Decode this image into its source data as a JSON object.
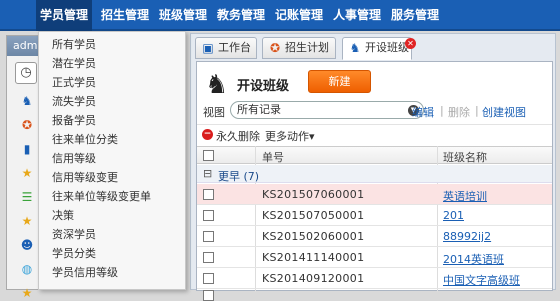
{
  "nav": {
    "items": [
      {
        "label": "学员管理",
        "active": true
      },
      {
        "label": "招生管理",
        "active": false
      },
      {
        "label": "班级管理",
        "active": false
      },
      {
        "label": "教务管理",
        "active": false
      },
      {
        "label": "记账管理",
        "active": false
      },
      {
        "label": "人事管理",
        "active": false
      },
      {
        "label": "服务管理",
        "active": false
      }
    ]
  },
  "left_panel": {
    "header": "adm"
  },
  "dropdown": {
    "items": [
      "所有学员",
      "潜在学员",
      "正式学员",
      "流失学员",
      "报备学员",
      "往来单位分类",
      "信用等级",
      "信用等级变更",
      "往来单位等级变更单",
      "决策",
      "资深学员",
      "学员分类",
      "学员信用等级"
    ]
  },
  "tabs": [
    {
      "label": "工作台",
      "icon": "monitor-icon"
    },
    {
      "label": "招生计划",
      "icon": "plan-icon"
    },
    {
      "label": "开设班级",
      "icon": "chess-knight-icon"
    }
  ],
  "page": {
    "title": "开设班级",
    "new_button": "新建",
    "view_label": "视图",
    "view_value": "所有记录",
    "edit_link": "编辑",
    "delete_link": "删除",
    "create_view_link": "创建视图",
    "separator": "|"
  },
  "toolbar": {
    "perm_delete": "永久删除",
    "more_actions": "更多动作",
    "more_caret": "▾"
  },
  "table": {
    "columns": [
      "单号",
      "班级名称"
    ],
    "group": {
      "toggle": "⊟",
      "label": "更早",
      "count": "(7)"
    },
    "rows": [
      {
        "number": "KS201507060001",
        "name": "英语培训"
      },
      {
        "number": "KS201507050001",
        "name": "201"
      },
      {
        "number": "KS201502060001",
        "name": "88992ij2"
      },
      {
        "number": "KS201411140001",
        "name": "2014英语班"
      },
      {
        "number": "KS201409120001",
        "name": "中国文字高级班"
      },
      {
        "number": "",
        "name": ""
      }
    ]
  },
  "colors": {
    "nav_bg": "#1a5fb4",
    "accent_orange": "#ee5f00",
    "link_blue": "#1a5fb4",
    "row_highlight": "#fbe3e3"
  }
}
